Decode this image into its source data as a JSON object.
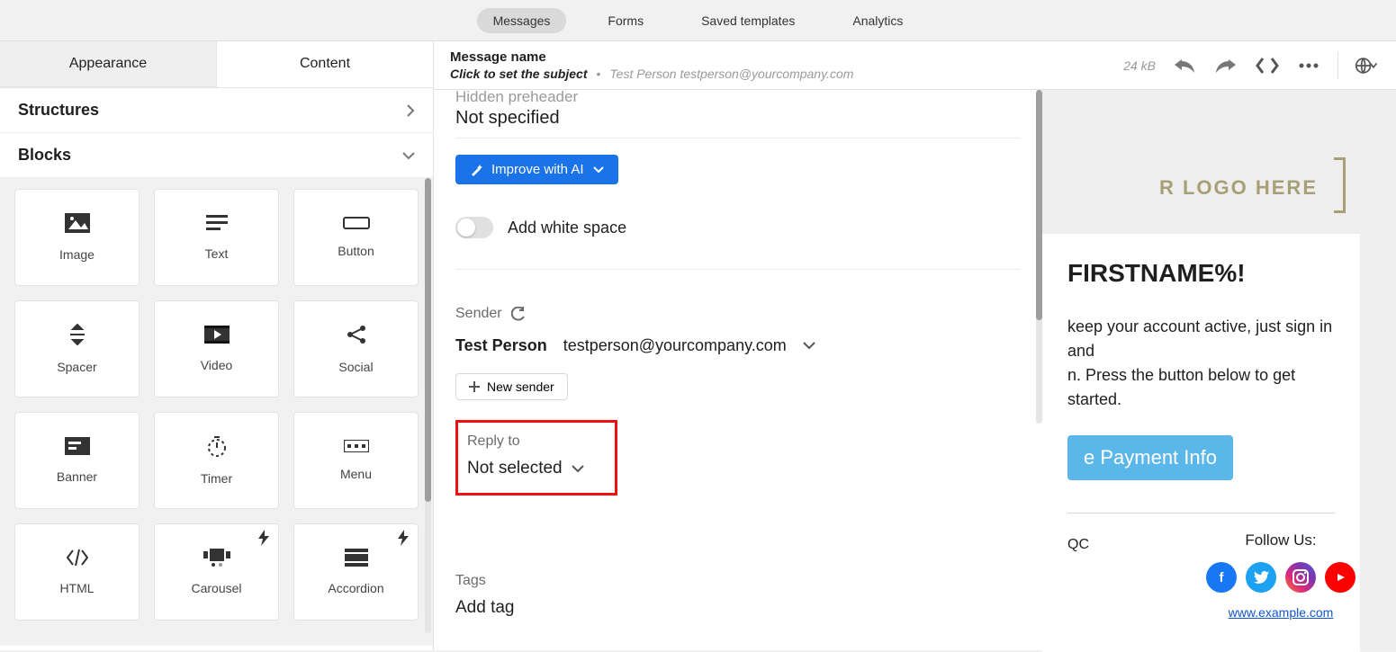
{
  "topnav": {
    "items": [
      "Messages",
      "Forms",
      "Saved templates",
      "Analytics"
    ],
    "activeIndex": 0
  },
  "sidebar": {
    "tabs": {
      "appearance": "Appearance",
      "content": "Content"
    },
    "sections": {
      "structures": "Structures",
      "blocks": "Blocks"
    },
    "blocks": [
      {
        "label": "Image",
        "icon": "🖼"
      },
      {
        "label": "Text",
        "icon": "≡"
      },
      {
        "label": "Button",
        "icon": "▭"
      },
      {
        "label": "Spacer",
        "icon": "⇅"
      },
      {
        "label": "Video",
        "icon": "🎞"
      },
      {
        "label": "Social",
        "icon": "share"
      },
      {
        "label": "Banner",
        "icon": "▤"
      },
      {
        "label": "Timer",
        "icon": "⏱"
      },
      {
        "label": "Menu",
        "icon": "⌨"
      },
      {
        "label": "HTML",
        "icon": "</>"
      },
      {
        "label": "Carousel",
        "icon": "◧",
        "badge": true
      },
      {
        "label": "Accordion",
        "icon": "≣",
        "badge": true
      }
    ]
  },
  "editorTop": {
    "messageNameLabel": "Message name",
    "subjectPlaceholder": "Click to set the subject",
    "testSender": "Test Person testperson@yourcompany.com",
    "size": "24 kB"
  },
  "settings": {
    "hiddenPreheader": "Hidden preheader",
    "notSpecified": "Not specified",
    "improve": "Improve with AI",
    "addWhiteSpace": "Add white space",
    "senderLabel": "Sender",
    "senderName": "Test Person",
    "senderEmail": "testperson@yourcompany.com",
    "newSender": "New sender",
    "replyToLabel": "Reply to",
    "replyToValue": "Not selected",
    "tagsLabel": "Tags",
    "addTag": "Add tag"
  },
  "preview": {
    "logoText": "R LOGO HERE",
    "greeting": "FIRSTNAME%!",
    "body1": "keep your account active, just sign in and",
    "body2": "n. Press the button below to get started.",
    "cta": "e Payment Info",
    "addr": "QC",
    "follow": "Follow Us:",
    "url": "www.example.com"
  }
}
